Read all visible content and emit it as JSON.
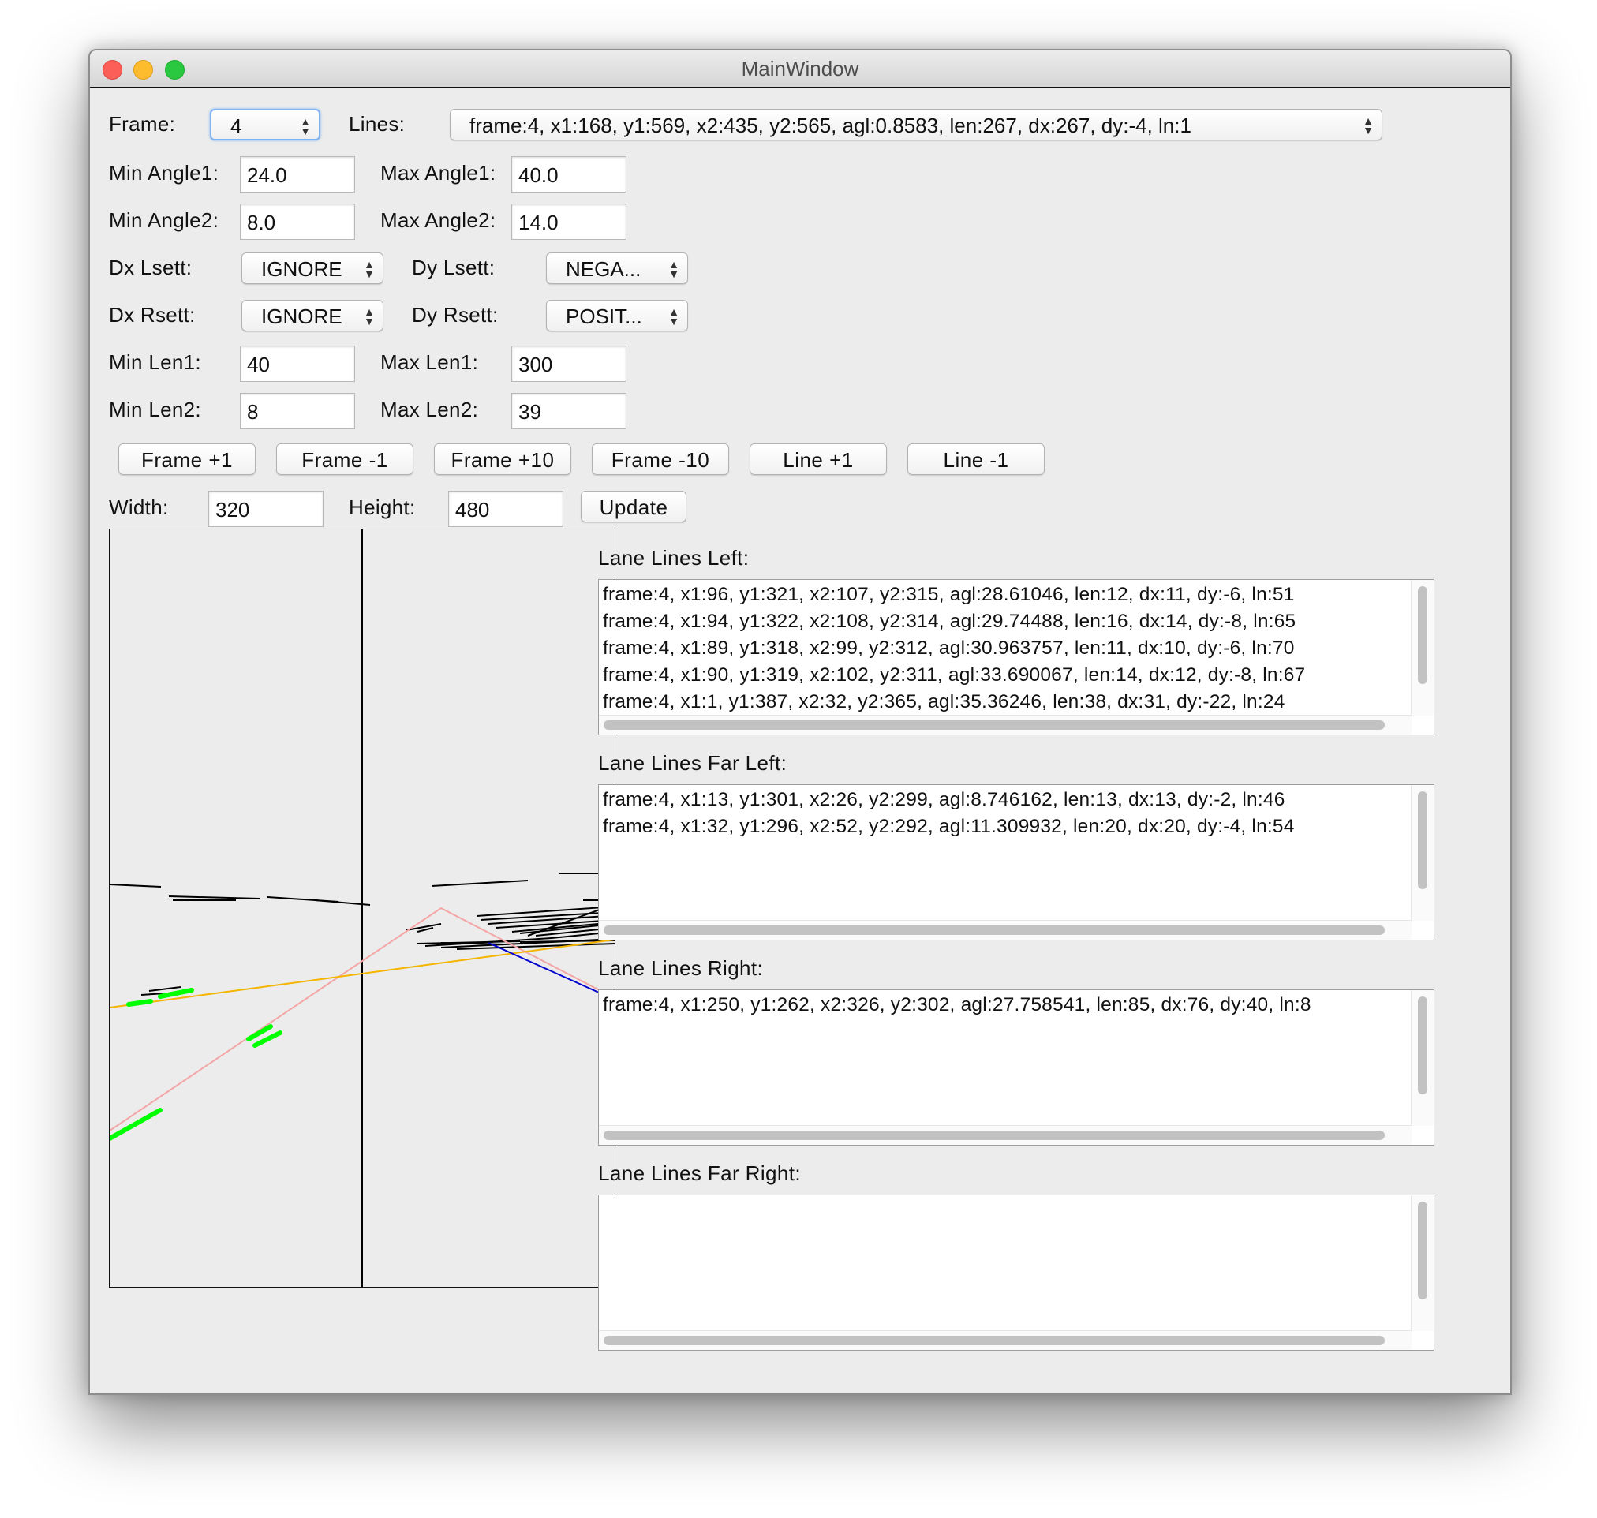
{
  "window": {
    "title": "MainWindow"
  },
  "controls": {
    "frame_label": "Frame:",
    "frame_value": "4",
    "lines_label": "Lines:",
    "lines_value": "frame:4, x1:168, y1:569, x2:435, y2:565, agl:0.8583, len:267, dx:267, dy:-4, ln:1",
    "min_angle1_label": "Min Angle1:",
    "min_angle1_value": "24.0",
    "max_angle1_label": "Max Angle1:",
    "max_angle1_value": "40.0",
    "min_angle2_label": "Min Angle2:",
    "min_angle2_value": "8.0",
    "max_angle2_label": "Max Angle2:",
    "max_angle2_value": "14.0",
    "dx_lsett_label": "Dx Lsett:",
    "dx_lsett_value": "IGNORE",
    "dy_lsett_label": "Dy Lsett:",
    "dy_lsett_value": "NEGA...",
    "dx_rsett_label": "Dx Rsett:",
    "dx_rsett_value": "IGNORE",
    "dy_rsett_label": "Dy Rsett:",
    "dy_rsett_value": "POSIT...",
    "min_len1_label": "Min Len1:",
    "min_len1_value": "40",
    "max_len1_label": "Max Len1:",
    "max_len1_value": "300",
    "min_len2_label": "Min Len2:",
    "min_len2_value": "8",
    "max_len2_label": "Max Len2:",
    "max_len2_value": "39",
    "buttons": [
      "Frame +1",
      "Frame -1",
      "Frame +10",
      "Frame -10",
      "Line +1",
      "Line -1"
    ],
    "width_label": "Width:",
    "width_value": "320",
    "height_label": "Height:",
    "height_value": "480",
    "update_label": "Update"
  },
  "lists": {
    "left": {
      "label": "Lane Lines Left:",
      "rows": [
        "frame:4, x1:96, y1:321, x2:107, y2:315, agl:28.61046, len:12, dx:11, dy:-6, ln:51",
        "frame:4, x1:94, y1:322, x2:108, y2:314, agl:29.74488, len:16, dx:14, dy:-8, ln:65",
        "frame:4, x1:89, y1:318, x2:99, y2:312, agl:30.963757, len:11, dx:10, dy:-6, ln:70",
        "frame:4, x1:90, y1:319, x2:102, y2:311, agl:33.690067, len:14, dx:12, dy:-8, ln:67",
        "frame:4, x1:1, y1:387, x2:32, y2:365, agl:35.36246, len:38, dx:31, dy:-22, ln:24"
      ]
    },
    "far_left": {
      "label": "Lane Lines Far Left:",
      "rows": [
        "frame:4, x1:13, y1:301, x2:26, y2:299, agl:8.746162, len:13, dx:13, dy:-2, ln:46",
        "frame:4, x1:32, y1:296, x2:52, y2:292, agl:11.309932, len:20, dx:20, dy:-4, ln:54"
      ]
    },
    "right": {
      "label": "Lane Lines Right:",
      "rows": [
        "frame:4, x1:250, y1:262, x2:326, y2:302, agl:27.758541, len:85, dx:76, dy:40, ln:8"
      ]
    },
    "far_right": {
      "label": "Lane Lines Far Right:",
      "rows": []
    }
  },
  "colors": {
    "detected_lines": "#000000",
    "left_candidates": "#00ff00",
    "guide_orange": "#f5b400",
    "guide_pink": "#f4a6a6",
    "right_line": "#0000cc"
  }
}
